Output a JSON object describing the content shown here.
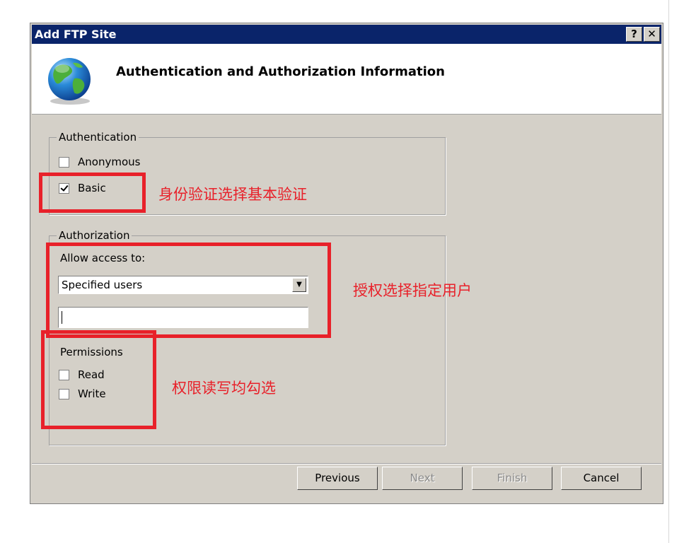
{
  "window": {
    "title": "Add FTP Site",
    "help_glyph": "?",
    "close_glyph": "✕"
  },
  "header": {
    "title": "Authentication and Authorization Information",
    "icon": "globe-icon"
  },
  "authentication": {
    "legend": "Authentication",
    "options": [
      {
        "label": "Anonymous",
        "checked": false
      },
      {
        "label": "Basic",
        "checked": true
      }
    ]
  },
  "authorization": {
    "legend": "Authorization",
    "allow_access_label": "Allow access to:",
    "allow_access_value": "Specified users",
    "users_value": "",
    "permissions": {
      "legend": "Permissions",
      "options": [
        {
          "label": "Read",
          "checked": false
        },
        {
          "label": "Write",
          "checked": false
        }
      ]
    }
  },
  "buttons": {
    "previous": "Previous",
    "next": "Next",
    "finish": "Finish",
    "cancel": "Cancel"
  },
  "annotations": {
    "authentication_note": "身份验证选择基本验证",
    "authorization_note": "授权选择指定用户",
    "permissions_note": "权限读写均勾选",
    "color": "#e8212a"
  }
}
